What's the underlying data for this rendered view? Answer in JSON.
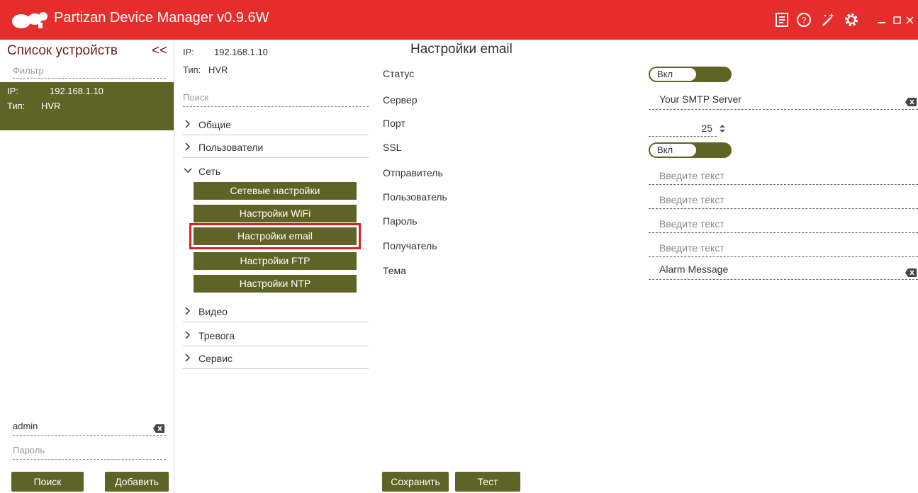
{
  "app": {
    "title": "Partizan Device Manager v0.9.6W",
    "accent": "#e52d2b",
    "olive": "#5d6425"
  },
  "titlebar_icons": [
    "journal-icon",
    "help-icon",
    "magic-wand-icon",
    "settings-gear-icon",
    "minimize-icon",
    "maximize-icon",
    "close-icon"
  ],
  "left": {
    "title": "Список устройств",
    "collapse": "<<",
    "filter_placeholder": "Фильтр",
    "device": {
      "ip_label": "IP:",
      "ip": "192.168.1.10",
      "type_label": "Тип:",
      "type": "HVR"
    },
    "login_value": "admin",
    "password_placeholder": "Пароль",
    "search_button": "Поиск",
    "add_button": "Добавить"
  },
  "middle": {
    "ip_label": "IP:",
    "ip": "192.168.1.10",
    "type_label": "Тип:",
    "type": "HVR",
    "search_placeholder": "Поиск",
    "tree": [
      {
        "label": "Общие",
        "expanded": false
      },
      {
        "label": "Пользователи",
        "expanded": false
      },
      {
        "label": "Сеть",
        "expanded": true
      },
      {
        "label": "Видео",
        "expanded": false
      },
      {
        "label": "Тревога",
        "expanded": false
      },
      {
        "label": "Сервис",
        "expanded": false
      }
    ],
    "network_sub": [
      "Сетевые настройки",
      "Настройки WiFi",
      "Настройки email",
      "Настройки FTP",
      "Настройки NTP"
    ],
    "active_sub": "Настройки email"
  },
  "main": {
    "title": "Настройки email",
    "labels": {
      "status": "Статус",
      "server": "Сервер",
      "port": "Порт",
      "ssl": "SSL",
      "sender": "Отправитель",
      "user": "Пользователь",
      "password": "Пароль",
      "recipient": "Получатель",
      "subject": "Тема"
    },
    "status_toggle": "Вкл",
    "ssl_toggle": "Вкл",
    "server_value": "Your SMTP Server",
    "port_value": "25",
    "text_placeholder": "Введите текст",
    "subject_value": "Alarm Message",
    "save_button": "Сохранить",
    "test_button": "Тест"
  }
}
